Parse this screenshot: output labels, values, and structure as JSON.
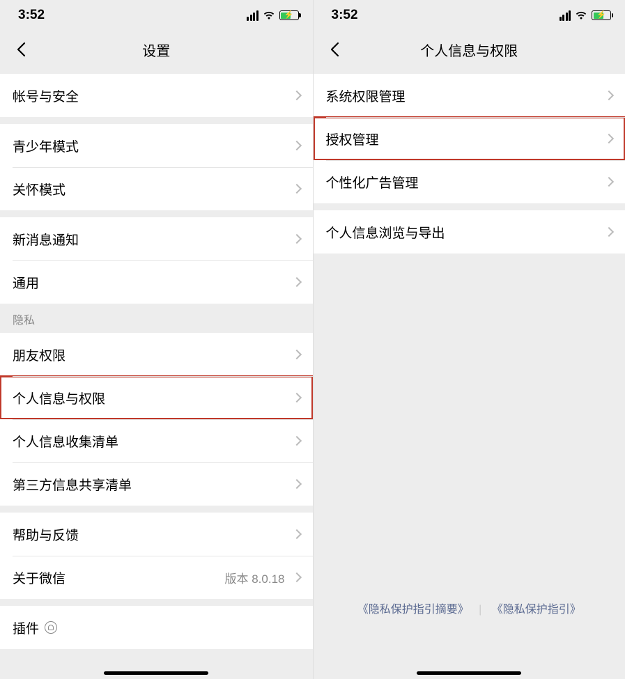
{
  "status": {
    "time": "3:52"
  },
  "left": {
    "title": "设置",
    "groups": [
      {
        "rows": [
          {
            "label": "帐号与安全"
          }
        ]
      },
      {
        "rows": [
          {
            "label": "青少年模式"
          },
          {
            "label": "关怀模式"
          }
        ]
      },
      {
        "rows": [
          {
            "label": "新消息通知"
          },
          {
            "label": "通用"
          }
        ]
      },
      {
        "header": "隐私",
        "rows": [
          {
            "label": "朋友权限"
          },
          {
            "label": "个人信息与权限",
            "highlight": true
          },
          {
            "label": "个人信息收集清单"
          },
          {
            "label": "第三方信息共享清单"
          }
        ]
      },
      {
        "rows": [
          {
            "label": "帮助与反馈"
          },
          {
            "label": "关于微信",
            "sub": "版本 8.0.18"
          }
        ]
      },
      {
        "rows": [
          {
            "label": "插件",
            "icon": "lightbulb"
          }
        ]
      }
    ]
  },
  "right": {
    "title": "个人信息与权限",
    "groups": [
      {
        "rows": [
          {
            "label": "系统权限管理"
          },
          {
            "label": "授权管理",
            "highlight": true
          },
          {
            "label": "个性化广告管理"
          }
        ]
      },
      {
        "rows": [
          {
            "label": "个人信息浏览与导出"
          }
        ]
      }
    ],
    "footer": {
      "link1": "《隐私保护指引摘要》",
      "link2": "《隐私保护指引》"
    }
  }
}
